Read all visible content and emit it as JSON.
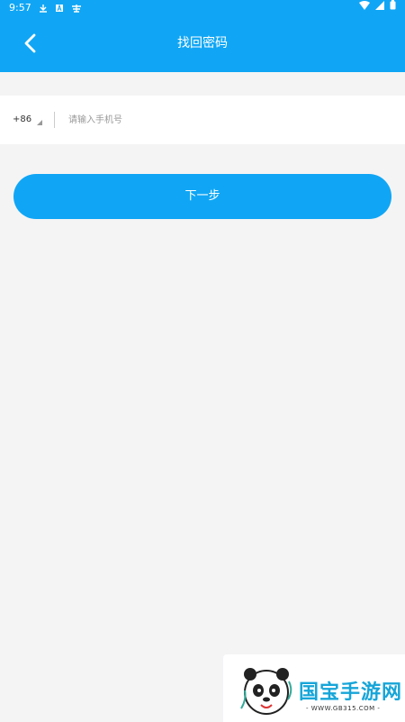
{
  "status_bar": {
    "time": "9:57",
    "icons": [
      "download-icon",
      "a-box-icon",
      "app-badge-icon",
      "wifi-icon",
      "signal-icon",
      "battery-icon"
    ]
  },
  "header": {
    "title": "找回密码",
    "back_icon": "back-arrow-icon"
  },
  "form": {
    "country_code": "+86",
    "phone_placeholder": "请输入手机号",
    "phone_value": ""
  },
  "actions": {
    "next_label": "下一步"
  },
  "watermark": {
    "brand": "国宝手游网",
    "url": "- WWW.GB315.COM -"
  },
  "colors": {
    "primary": "#10a6f5",
    "background": "#f4f4f5",
    "panel": "#ffffff"
  }
}
